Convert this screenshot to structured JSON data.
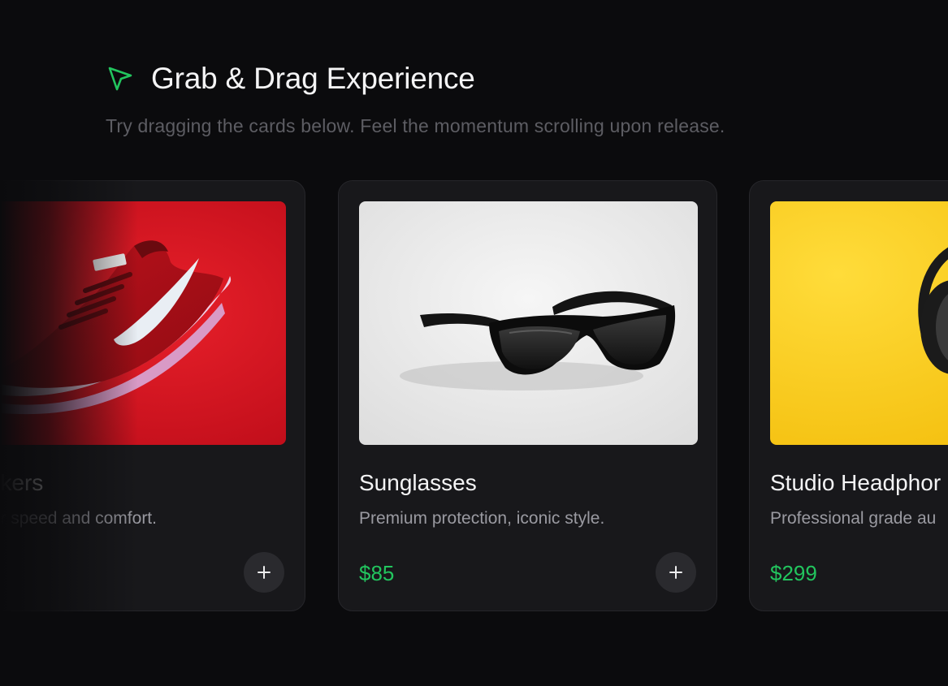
{
  "header": {
    "title": "Grab & Drag Experience",
    "subtitle": "Try dragging the cards below. Feel the momentum scrolling upon release.",
    "icon": "cursor-arrow-icon",
    "accent": "#22c55e"
  },
  "cards": [
    {
      "title": "Sneakers",
      "description": "ered for speed and comfort.",
      "price": "",
      "image": "red-sneaker-image",
      "image_bg": "#d0101e"
    },
    {
      "title": "Sunglasses",
      "description": "Premium protection, iconic style.",
      "price": "$85",
      "image": "sunglasses-image",
      "image_bg": "#ececec"
    },
    {
      "title": "Studio Headphor",
      "description": "Professional grade au",
      "price": "$299",
      "image": "headphones-image",
      "image_bg": "#f5c518"
    }
  ],
  "colors": {
    "background": "#0b0b0d",
    "card": "#18181b",
    "price": "#22c55e"
  }
}
